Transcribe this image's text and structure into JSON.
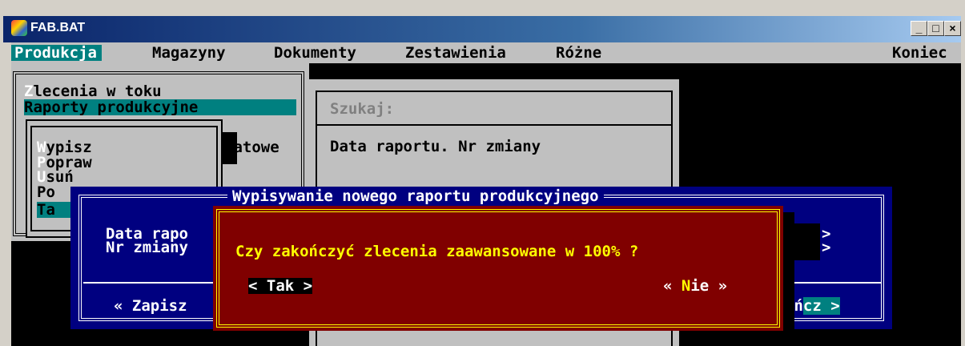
{
  "window": {
    "title": "FAB.BAT",
    "min": "_",
    "max": "□",
    "close": "×"
  },
  "menu": {
    "items": [
      "Produkcja",
      "Magazyny",
      "Dokumenty",
      "Zestawienia",
      "Różne"
    ],
    "exit": "Koniec"
  },
  "menu1": {
    "items": [
      {
        "hot": "Z",
        "rest": "lecenia w toku"
      },
      {
        "hot": "",
        "rest": "Raporty produkcyjne"
      }
    ]
  },
  "menu2": {
    "items": [
      {
        "hot": "W",
        "rest": "ypisz"
      },
      {
        "hot": "P",
        "rest": "opraw"
      },
      {
        "hot": "U",
        "rest": "suń"
      },
      {
        "hot": "",
        "rest": "Po"
      },
      {
        "hot": "",
        "rest": "Ta"
      }
    ],
    "side_text": "tatowe"
  },
  "search": {
    "label": "Szukaj:",
    "column": "Data raportu. Nr zmiany"
  },
  "form": {
    "title": "Wypisywanie nowego raportu produkcyjnego",
    "field1": "Data rapo",
    "field2": "Nr zmiany",
    "arrow1": ">",
    "arrow2": ">",
    "save": "« Zapisz",
    "end_prefix": "oń",
    "end_suffix": "cz >"
  },
  "dialog": {
    "question": "Czy zakończyć zlecenia zaawansowane w 100% ?",
    "yes": "< Tak >",
    "no_open": "« ",
    "no_hot": "N",
    "no_rest": "ie »"
  },
  "colors": {
    "desktop": "#000000",
    "menubar": "#c0c0c0",
    "cyan": "#008080",
    "blue": "#000080",
    "dialog": "#800000",
    "yellow": "#ffff00"
  }
}
